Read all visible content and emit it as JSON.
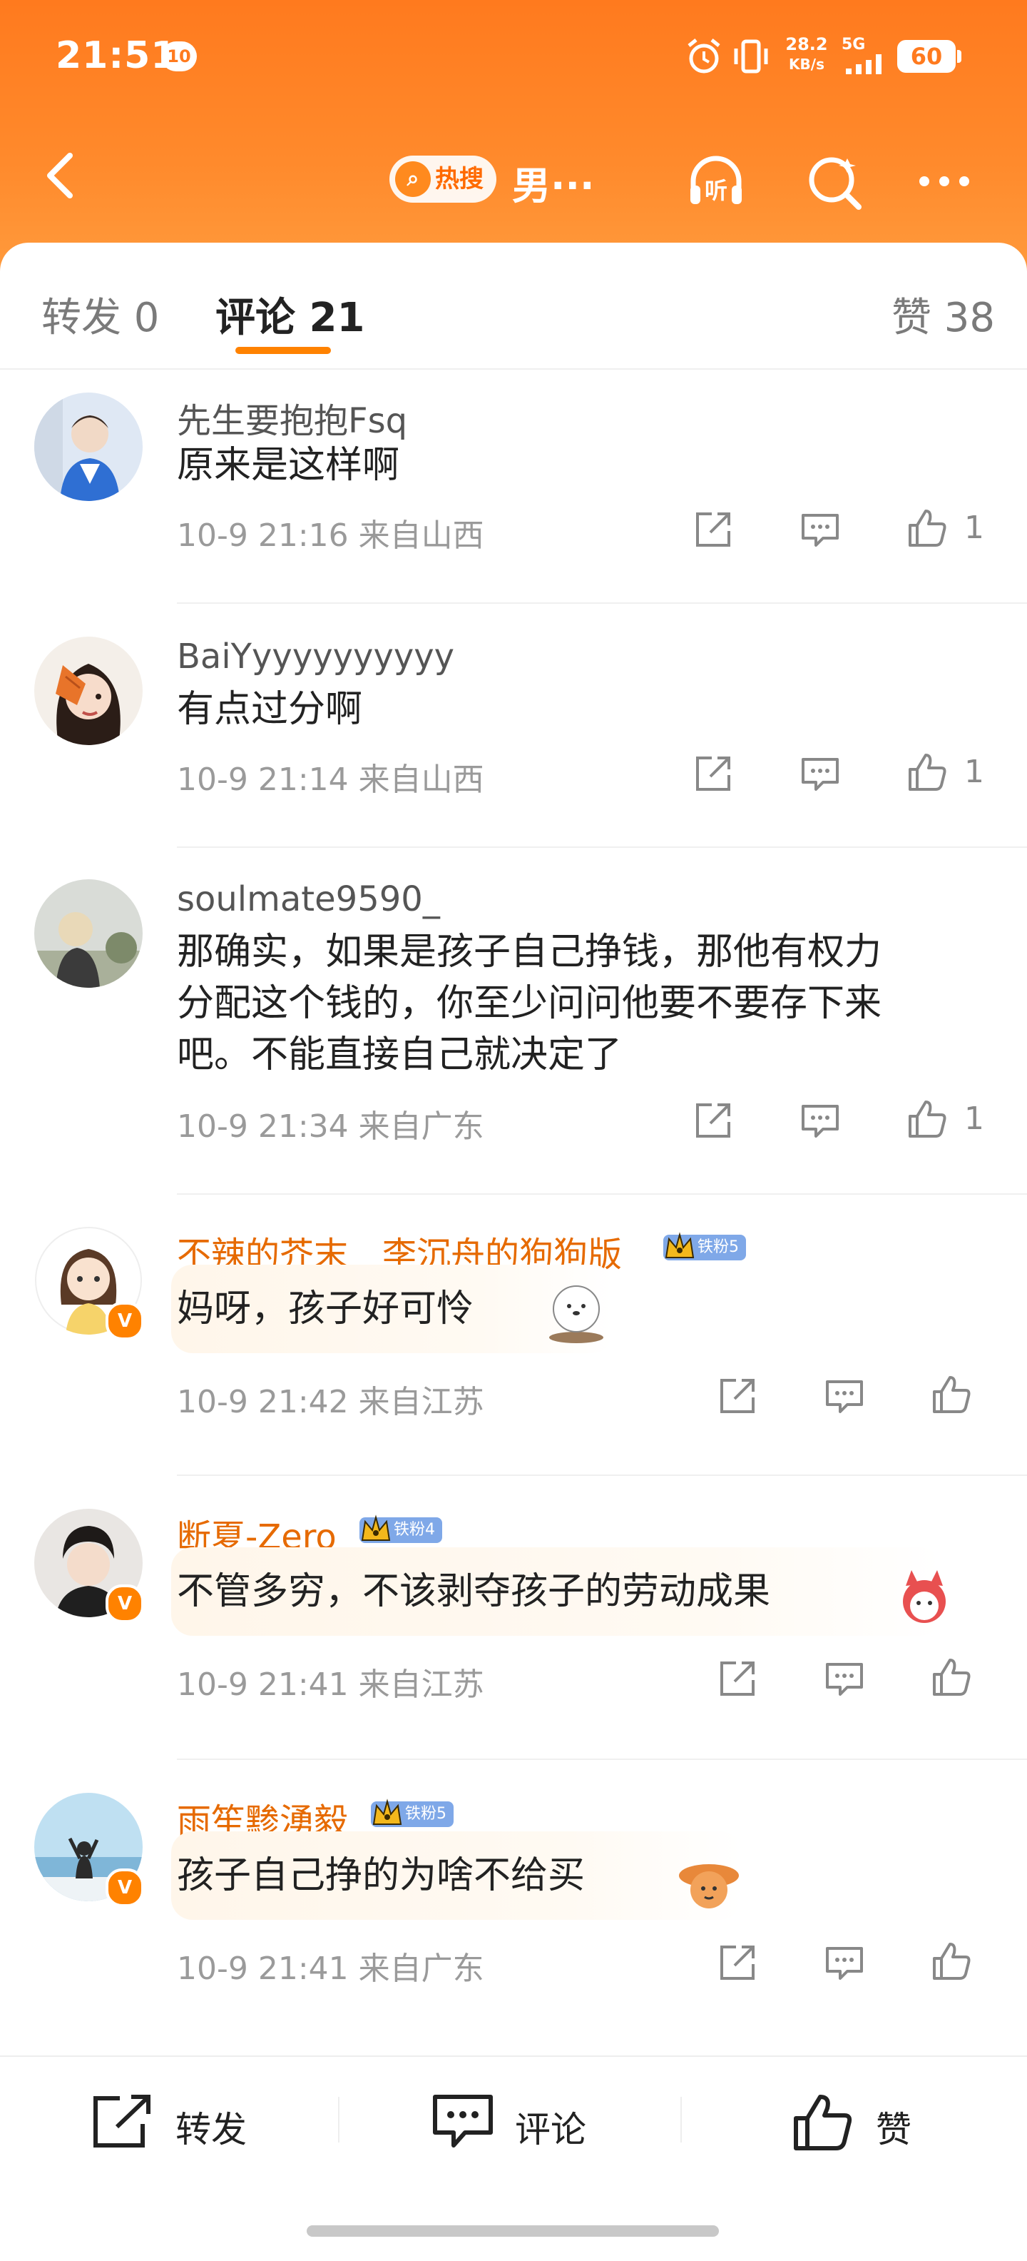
{
  "status_bar": {
    "time": "21:51",
    "notif_badge": "10",
    "net_speed_value": "28.2",
    "net_speed_unit": "KB/s",
    "network": "5G",
    "battery": "60"
  },
  "nav": {
    "hot_label": "热搜",
    "title": "男···",
    "listen_label": "听"
  },
  "tabs": {
    "repost": "转发 0",
    "comments": "评论 21",
    "likes": "赞 38"
  },
  "comments": [
    {
      "user": "先生要抱抱Fsq",
      "text": "原来是这样啊",
      "meta": "10-9 21:16  来自山西",
      "likes": "1"
    },
    {
      "user": "BaiYyyyyyyyyyy",
      "text": "有点过分啊",
      "meta": "10-9 21:14  来自山西",
      "likes": "1"
    },
    {
      "user": "soulmate9590_",
      "text_lines": [
        "那确实，如果是孩子自己挣钱，那他有权力",
        "分配这个钱的，你至少问问他要不要存下来",
        "吧。不能直接自己就决定了"
      ],
      "meta": "10-9 21:34  来自广东",
      "likes": "1"
    },
    {
      "user": "不辣的芥末__李沉舟的狗狗版",
      "fan_badge": "铁粉5",
      "text": "妈呀，孩子好可怜",
      "meta": "10-9 21:42  来自江苏",
      "verified": "V"
    },
    {
      "user": "断夏-Zero",
      "fan_badge": "铁粉4",
      "text": "不管多穷，不该剥夺孩子的劳动成果",
      "meta": "10-9 21:41  来自江苏",
      "verified": "V"
    },
    {
      "user": "雨笙黪湧毅",
      "fan_badge": "铁粉5",
      "text": "孩子自己挣的为啥不给买",
      "meta": "10-9 21:41  来自广东",
      "verified": "V"
    }
  ],
  "bottom_bar": {
    "repost": "转发",
    "comment": "评论",
    "like": "赞"
  },
  "colors": {
    "brand_orange": "#ff8200",
    "header_top": "#ff7a1e",
    "username_orange": "#e66a00",
    "fan_badge_blue": "#7fa8e8"
  },
  "icons": [
    "back-icon",
    "search-icon",
    "listen-icon",
    "more-icon",
    "share-icon",
    "comment-icon",
    "like-icon",
    "crown-icon",
    "verified-icon"
  ]
}
